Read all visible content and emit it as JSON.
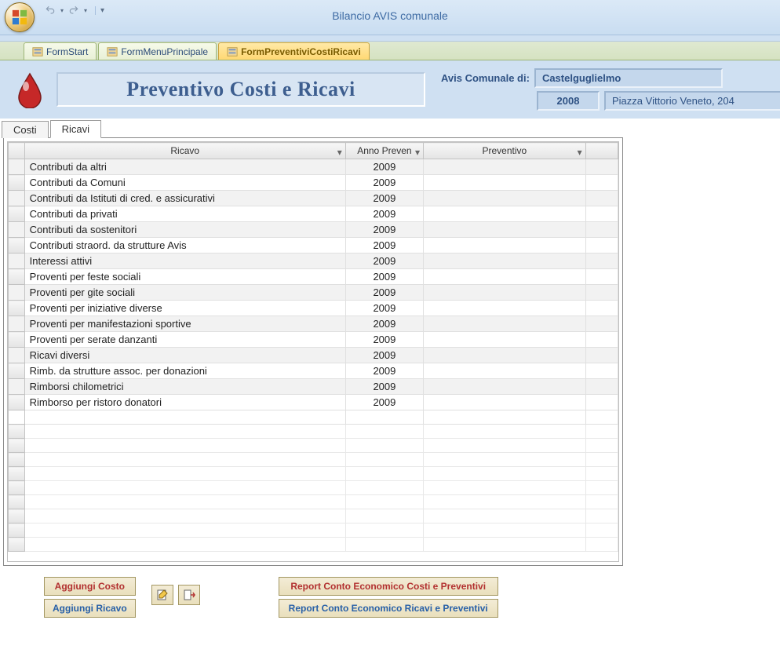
{
  "app_title": "Bilancio AVIS comunale",
  "doc_tabs": [
    {
      "label": "FormStart",
      "active": false
    },
    {
      "label": "FormMenuPrincipale",
      "active": false
    },
    {
      "label": "FormPreventiviCostiRicavi",
      "active": true
    }
  ],
  "form_header": {
    "title": "Preventivo Costi e Ricavi",
    "label_comune": "Avis Comunale di:",
    "comune_name": "Castelguglielmo",
    "year": "2008",
    "address": "Piazza Vittorio Veneto, 204"
  },
  "inner_tabs": {
    "costi": "Costi",
    "ricavi": "Ricavi"
  },
  "grid": {
    "columns": {
      "ricavo": "Ricavo",
      "anno": "Anno Preven",
      "preventivo": "Preventivo"
    },
    "rows": [
      {
        "ricavo": "Contributi da altri",
        "anno": "2009",
        "preventivo": ""
      },
      {
        "ricavo": "Contributi da Comuni",
        "anno": "2009",
        "preventivo": ""
      },
      {
        "ricavo": "Contributi da Istituti di cred. e assicurativi",
        "anno": "2009",
        "preventivo": ""
      },
      {
        "ricavo": "Contributi da privati",
        "anno": "2009",
        "preventivo": ""
      },
      {
        "ricavo": "Contributi da sostenitori",
        "anno": "2009",
        "preventivo": ""
      },
      {
        "ricavo": "Contributi straord. da strutture Avis",
        "anno": "2009",
        "preventivo": ""
      },
      {
        "ricavo": "Interessi attivi",
        "anno": "2009",
        "preventivo": ""
      },
      {
        "ricavo": "Proventi per feste sociali",
        "anno": "2009",
        "preventivo": ""
      },
      {
        "ricavo": "Proventi per gite sociali",
        "anno": "2009",
        "preventivo": ""
      },
      {
        "ricavo": "Proventi per iniziative diverse",
        "anno": "2009",
        "preventivo": ""
      },
      {
        "ricavo": "Proventi per manifestazioni sportive",
        "anno": "2009",
        "preventivo": ""
      },
      {
        "ricavo": "Proventi per serate danzanti",
        "anno": "2009",
        "preventivo": ""
      },
      {
        "ricavo": "Ricavi diversi",
        "anno": "2009",
        "preventivo": ""
      },
      {
        "ricavo": "Rimb. da strutture assoc. per donazioni",
        "anno": "2009",
        "preventivo": ""
      },
      {
        "ricavo": "Rimborsi chilometrici",
        "anno": "2009",
        "preventivo": ""
      },
      {
        "ricavo": "Rimborso per ristoro donatori",
        "anno": "2009",
        "preventivo": ""
      }
    ]
  },
  "buttons": {
    "aggiungi_costo": "Aggiungi Costo",
    "aggiungi_ricavo": "Aggiungi Ricavo",
    "report_costi": "Report Conto Economico Costi e Preventivi",
    "report_ricavi": "Report Conto Economico Ricavi e Preventivi"
  }
}
